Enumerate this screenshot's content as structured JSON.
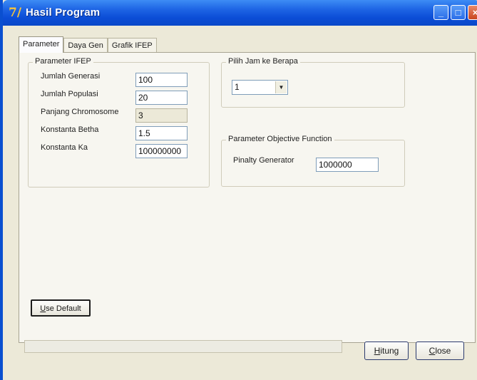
{
  "window": {
    "title": "Hasil Program",
    "icon": "7/",
    "accent_color": "#0a4fd0"
  },
  "tabs": [
    {
      "label": "Parameter",
      "active": true
    },
    {
      "label": "Daya Gen",
      "active": false
    },
    {
      "label": "Grafik IFEP",
      "active": false
    }
  ],
  "ifep": {
    "title": "Parameter IFEP",
    "jumlah_generasi": {
      "label": "Jumlah Generasi",
      "value": "100"
    },
    "jumlah_populasi": {
      "label": "Jumlah Populasi",
      "value": "20"
    },
    "panjang_chromosome": {
      "label": "Panjang Chromosome",
      "value": "3"
    },
    "konstanta_betha": {
      "label": "Konstanta Betha",
      "value": "1.5"
    },
    "konstanta_ka": {
      "label": "Konstanta Ka",
      "value": "100000000"
    }
  },
  "jam": {
    "title": "Pilih Jam ke Berapa",
    "selected": "1"
  },
  "objective": {
    "title": "Parameter Objective Function",
    "pinalty": {
      "label": "Pinalty Generator",
      "value": "1000000"
    }
  },
  "buttons": {
    "use_default": {
      "mnemonic": "U",
      "rest": "se Default"
    },
    "hitung": {
      "mnemonic": "H",
      "rest": "itung"
    },
    "close": {
      "mnemonic": "C",
      "rest": "lose"
    }
  }
}
